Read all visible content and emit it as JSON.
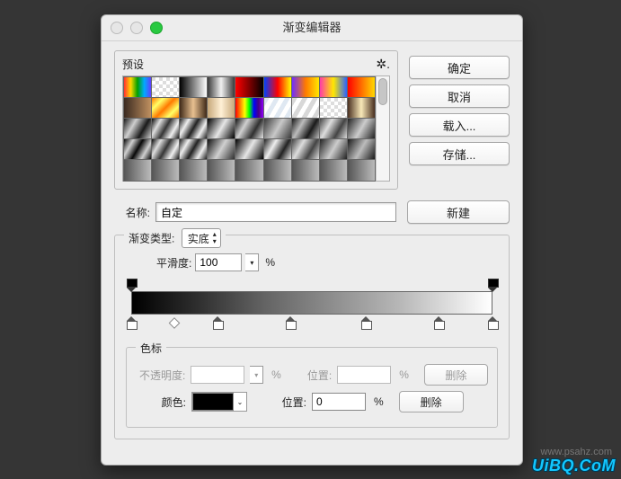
{
  "window": {
    "title": "渐变编辑器"
  },
  "buttons": {
    "ok": "确定",
    "cancel": "取消",
    "load": "载入...",
    "save": "存储...",
    "new": "新建"
  },
  "presets": {
    "label": "预设"
  },
  "name": {
    "label": "名称:",
    "value": "自定"
  },
  "gradient_type": {
    "label": "渐变类型:",
    "value": "实底"
  },
  "smoothness": {
    "label": "平滑度:",
    "value": "100",
    "unit": "%"
  },
  "stops_group": {
    "label": "色标"
  },
  "opacity_row": {
    "label": "不透明度:",
    "value": "",
    "unit": "%",
    "pos_label": "位置:",
    "pos_value": "",
    "pos_unit": "%",
    "delete": "删除"
  },
  "color_row": {
    "label": "颜色:",
    "pos_label": "位置:",
    "pos_value": "0",
    "pos_unit": "%",
    "delete": "删除"
  },
  "swatches": [
    "linear-gradient(90deg,#ff3030,#ffd800,#00a000,#00aaff,#6040ff)",
    "repeating-conic-gradient(#fff 0 25%,#ddd 0 50%) 0 0/8px 8px",
    "linear-gradient(90deg,#000,#fff)",
    "linear-gradient(90deg,#3a3a3a,#f0f0f0,#3a3a3a)",
    "linear-gradient(90deg,#ff0000,#000)",
    "linear-gradient(90deg,#0040ff,#ff0000,#ffff00)",
    "linear-gradient(90deg,#6d2fff,#ff7a00,#ffe800)",
    "linear-gradient(90deg,#ff3aa8,#ffe800,#2a62ff)",
    "linear-gradient(90deg,#ff0000,#ffd800)",
    "linear-gradient(90deg,#3a2a20,#c09060)",
    "linear-gradient(135deg,#ff7a00,#ffff66,#ff7a00,#ffff66,#ff7a00)",
    "linear-gradient(90deg,#402a18,#e8c090,#402a18)",
    "linear-gradient(90deg,#c7a87a,#fff0d6,#c7a87a)",
    "linear-gradient(90deg,#ff0000,#ff7f00,#ffff00,#00ff00,#0000ff,#4b0082,#8f00ff)",
    "repeating-linear-gradient(120deg,#dfe8f2 0 5px,#ffffff 5px 10px)",
    "repeating-linear-gradient(120deg,#d8d8d8 0 5px,#ffffff 5px 10px)",
    "repeating-conic-gradient(#fff 0 25%,#ddd 0 50%) 0 0/8px 8px",
    "linear-gradient(90deg,#4a3020,#f8e8b8,#4a3020)",
    "linear-gradient(120deg,#1a1a1a,#cfcfcf,#1a1a1a,#cfcfcf)",
    "linear-gradient(120deg,#0a0a0a,#dedede,#353535,#f0f0f0,#1a1a1a)",
    "linear-gradient(120deg,#222,#eee,#222,#eee,#222)",
    "linear-gradient(120deg,#000,#e6e6e6,#000)",
    "linear-gradient(120deg,#101010,#d0d0d0,#303030,#e8e8e8)",
    "linear-gradient(120deg,#3a3a3a,#c8c8c8,#3a3a3a)",
    "linear-gradient(120deg,#1a1a1a,#bcbcbc,#1a1a1a,#bcbcbc)",
    "linear-gradient(120deg,#444,#ddd,#444,#ddd)",
    "linear-gradient(120deg,#222,#ccc,#222)",
    "linear-gradient(120deg,#070707,#d0d0d0,#070707,#d0d0d0,#070707)",
    "linear-gradient(120deg,#0a0a0a,#dedede,#353535,#f0f0f0,#1a1a1a)",
    "linear-gradient(120deg,#222,#eee,#222,#eee,#222)",
    "linear-gradient(120deg,#101010,#d0d0d0,#303030)",
    "linear-gradient(120deg,#000,#e6e6e6,#000)",
    "linear-gradient(120deg,#222,#eee,#222,#eee)",
    "linear-gradient(120deg,#444,#ddd,#444,#ddd)",
    "linear-gradient(120deg,#222,#ccc,#222)",
    "linear-gradient(120deg,#1a1a1a,#bcbcbc,#1a1a1a)",
    "linear-gradient(90deg,#555,#bbb)",
    "linear-gradient(90deg,#555,#bbb)",
    "linear-gradient(90deg,#555,#bbb)",
    "linear-gradient(90deg,#555,#bbb)",
    "linear-gradient(90deg,#555,#bbb)",
    "linear-gradient(90deg,#555,#bbb)",
    "linear-gradient(90deg,#555,#bbb)",
    "linear-gradient(90deg,#555,#bbb)",
    "linear-gradient(90deg,#555,#bbb)"
  ],
  "gradient_bar": "linear-gradient(90deg,#000000 0%,#2e2e2e 18%,#646464 37%,#8c8c8c 55%,#b6b6b6 74%,#ffffff 100%)",
  "color_stops_pct": [
    0,
    24,
    44,
    65,
    85,
    100
  ],
  "opacity_stops_pct": [
    0,
    100
  ],
  "midpoint_pct": 12,
  "selected_color": "#000000",
  "watermark": "UiBQ.CoM"
}
